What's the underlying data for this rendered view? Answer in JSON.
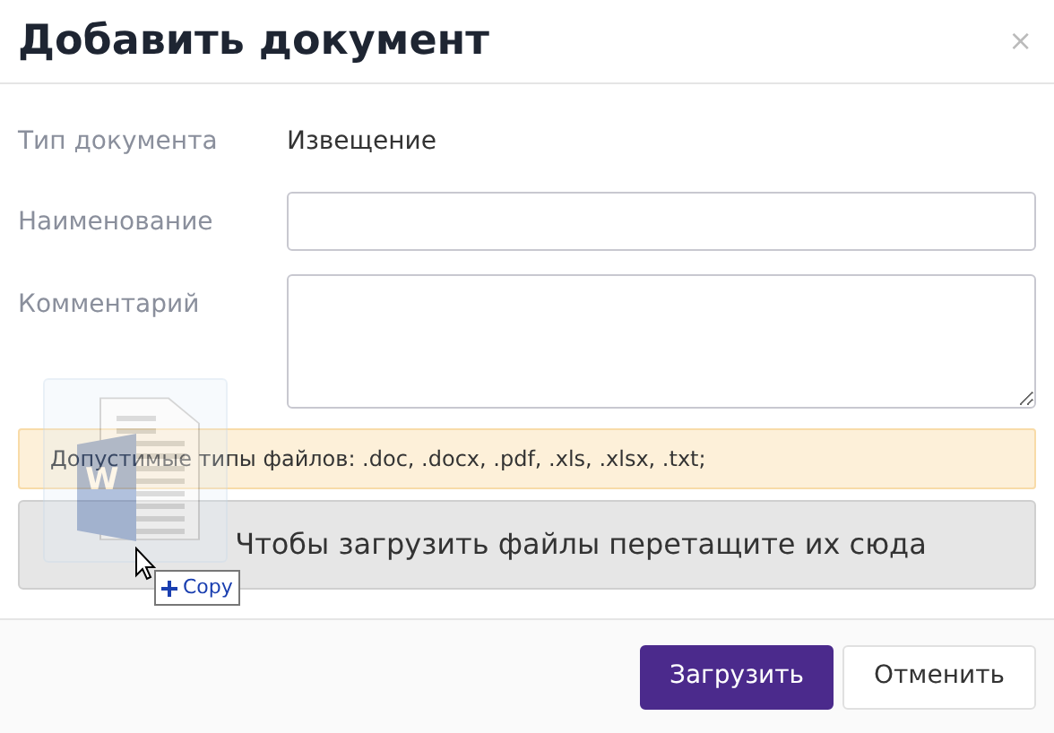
{
  "dialog": {
    "title": "Добавить документ",
    "close": "×"
  },
  "fields": [
    {
      "kind": "text",
      "label": "Тип документа",
      "value": "Извещение"
    },
    {
      "kind": "input",
      "label": "Наименование"
    },
    {
      "kind": "textarea",
      "label": "Комментарий"
    }
  ],
  "info": "Допустимые типы файлов: .doc, .docx, .pdf, .xls, .xlsx, .txt;",
  "dropzone": "Чтобы загрузить файлы перетащите их сюда",
  "drag": {
    "icon_letter": "W",
    "action": "Copy"
  },
  "buttons": [
    {
      "kind": "primary",
      "label": "Загрузить"
    },
    {
      "kind": "secondary",
      "label": "Отменить"
    }
  ]
}
